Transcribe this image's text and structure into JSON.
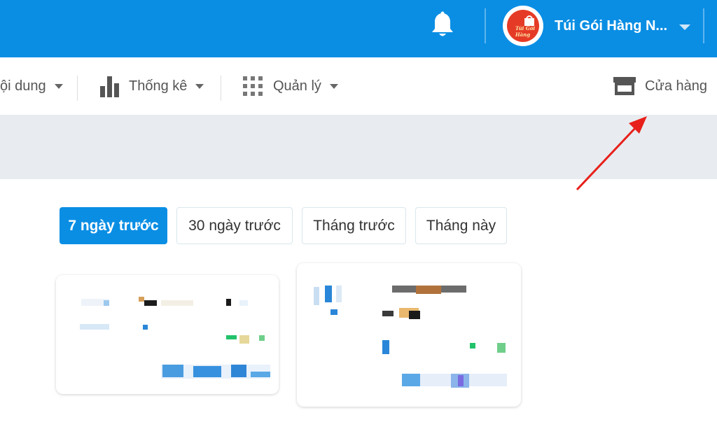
{
  "header": {
    "shop_name": "Túi Gói Hàng N...",
    "avatar_logo_text": "Túi Gói Hàng",
    "bell_icon": "bell-icon",
    "caret_icon": "caret-down-icon",
    "brand_color": "#0a8ee4"
  },
  "nav": {
    "content_label": "ội dung",
    "stats_label": "Thống kê",
    "manage_label": "Quản lý",
    "store_label": "Cửa hàng",
    "icons": [
      "bar-chart-icon",
      "grid-icon",
      "store-icon"
    ]
  },
  "filters": {
    "items": [
      "7 ngày trước",
      "30 ngày trước",
      "Tháng trước",
      "Tháng này"
    ],
    "active": "7 ngày trước"
  },
  "annotation": {
    "arrow_color": "#e8201b"
  }
}
